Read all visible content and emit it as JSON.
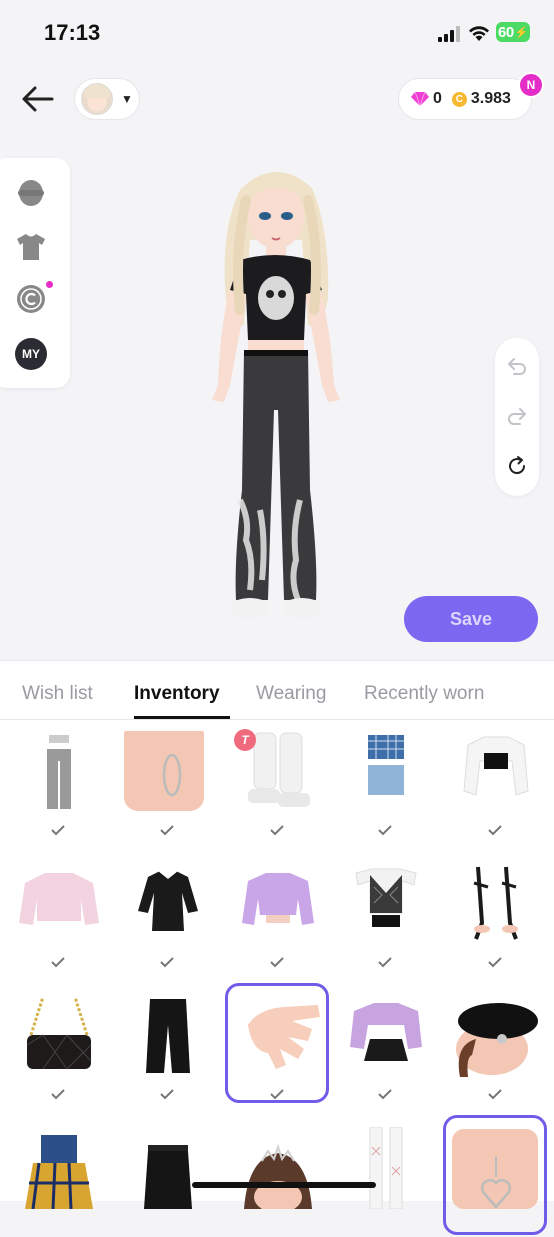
{
  "status_bar": {
    "time": "17:13",
    "battery": "60"
  },
  "currency": {
    "gems": "0",
    "coins": "3.983",
    "coin_symbol": "C",
    "new_badge": "N"
  },
  "categories": [
    {
      "icon": "head-icon"
    },
    {
      "icon": "shirt-icon"
    },
    {
      "icon": "copyright-icon"
    },
    {
      "icon": "my-icon",
      "label": "MY"
    }
  ],
  "history": [
    {
      "icon": "undo-icon"
    },
    {
      "icon": "redo-icon"
    },
    {
      "icon": "reset-icon"
    }
  ],
  "save_label": "Save",
  "tabs": [
    {
      "label": "Wish list"
    },
    {
      "label": "Inventory",
      "active": true
    },
    {
      "label": "Wearing"
    },
    {
      "label": "Recently worn"
    }
  ],
  "brand_badge": "T",
  "items": [
    {
      "name": "gray-jeans-outfit",
      "checked": true
    },
    {
      "name": "silver-hoop-earring",
      "checked": true
    },
    {
      "name": "white-platform-boots",
      "checked": true,
      "brand": true
    },
    {
      "name": "denim-plaid-set",
      "checked": true
    },
    {
      "name": "white-jacket-crop-top",
      "checked": true
    },
    {
      "name": "pink-sweatshirt",
      "checked": true
    },
    {
      "name": "black-collar-dress",
      "checked": true
    },
    {
      "name": "lilac-cardigan",
      "checked": true
    },
    {
      "name": "argyle-vest",
      "checked": true
    },
    {
      "name": "black-strappy-heels",
      "checked": true
    },
    {
      "name": "quilted-chain-bag",
      "checked": true
    },
    {
      "name": "black-wide-pants",
      "checked": true
    },
    {
      "name": "nude-nails",
      "checked": true,
      "selected": true
    },
    {
      "name": "lilac-jacket-skirt",
      "checked": true
    },
    {
      "name": "black-beret",
      "checked": true
    },
    {
      "name": "plaid-corset-dress",
      "checked": false
    },
    {
      "name": "black-leather-skirt",
      "checked": false
    },
    {
      "name": "tiara-hair",
      "checked": false
    },
    {
      "name": "white-lace-boots",
      "checked": false
    },
    {
      "name": "heart-earring",
      "checked": false,
      "selected": true
    }
  ],
  "colors": {
    "accent": "#7b67f0",
    "pink": "#e52dc8",
    "battery": "#4cd964"
  }
}
